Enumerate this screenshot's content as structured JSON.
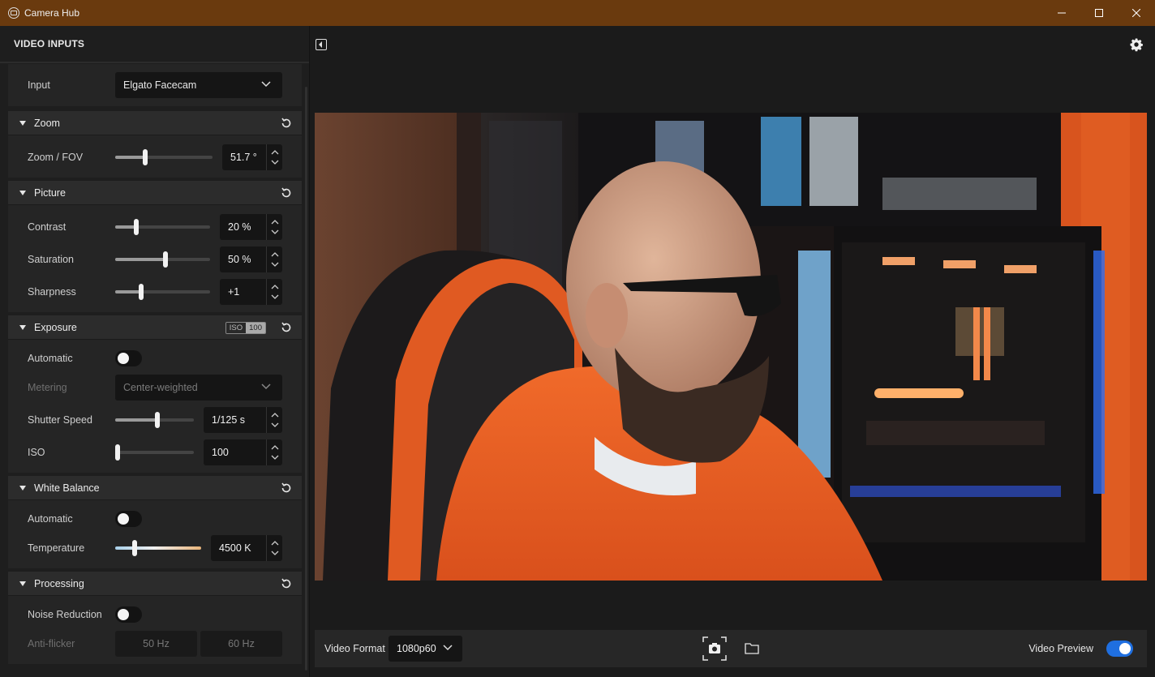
{
  "window": {
    "title": "Camera Hub",
    "controls": [
      "minimize",
      "maximize",
      "close"
    ]
  },
  "sidebar": {
    "header": "VIDEO INPUTS",
    "input": {
      "label": "Input",
      "value": "Elgato Facecam"
    },
    "zoom": {
      "title": "Zoom",
      "fov": {
        "label": "Zoom / FOV",
        "value": "51.7 °",
        "level": 0.28
      }
    },
    "picture": {
      "title": "Picture",
      "contrast": {
        "label": "Contrast",
        "value": "20 %",
        "level": 0.2
      },
      "saturation": {
        "label": "Saturation",
        "value": "50 %",
        "level": 0.5
      },
      "sharpness": {
        "label": "Sharpness",
        "value": "+1",
        "level": 0.25
      }
    },
    "exposure": {
      "title": "Exposure",
      "iso_badge": {
        "a": "ISO",
        "b": "100"
      },
      "automatic": {
        "label": "Automatic",
        "on": false
      },
      "metering": {
        "label": "Metering",
        "value": "Center-weighted"
      },
      "shutter": {
        "label": "Shutter Speed",
        "value": "1/125 s",
        "level": 0.5
      },
      "iso": {
        "label": "ISO",
        "value": "100",
        "level": 0.0
      }
    },
    "white_balance": {
      "title": "White Balance",
      "automatic": {
        "label": "Automatic",
        "on": false
      },
      "temperature": {
        "label": "Temperature",
        "value": "4500 K",
        "level": 0.2
      }
    },
    "processing": {
      "title": "Processing",
      "noise_reduction": {
        "label": "Noise Reduction",
        "on": false
      },
      "anti_flicker": {
        "label": "Anti-flicker",
        "options": [
          "50 Hz",
          "60 Hz"
        ]
      }
    }
  },
  "bottom": {
    "video_format_label": "Video Format",
    "video_format_value": "1080p60",
    "video_preview_label": "Video Preview",
    "video_preview_on": true
  },
  "colors": {
    "titlebar": "#6a3a0e",
    "accent": "#1f6fe0"
  }
}
